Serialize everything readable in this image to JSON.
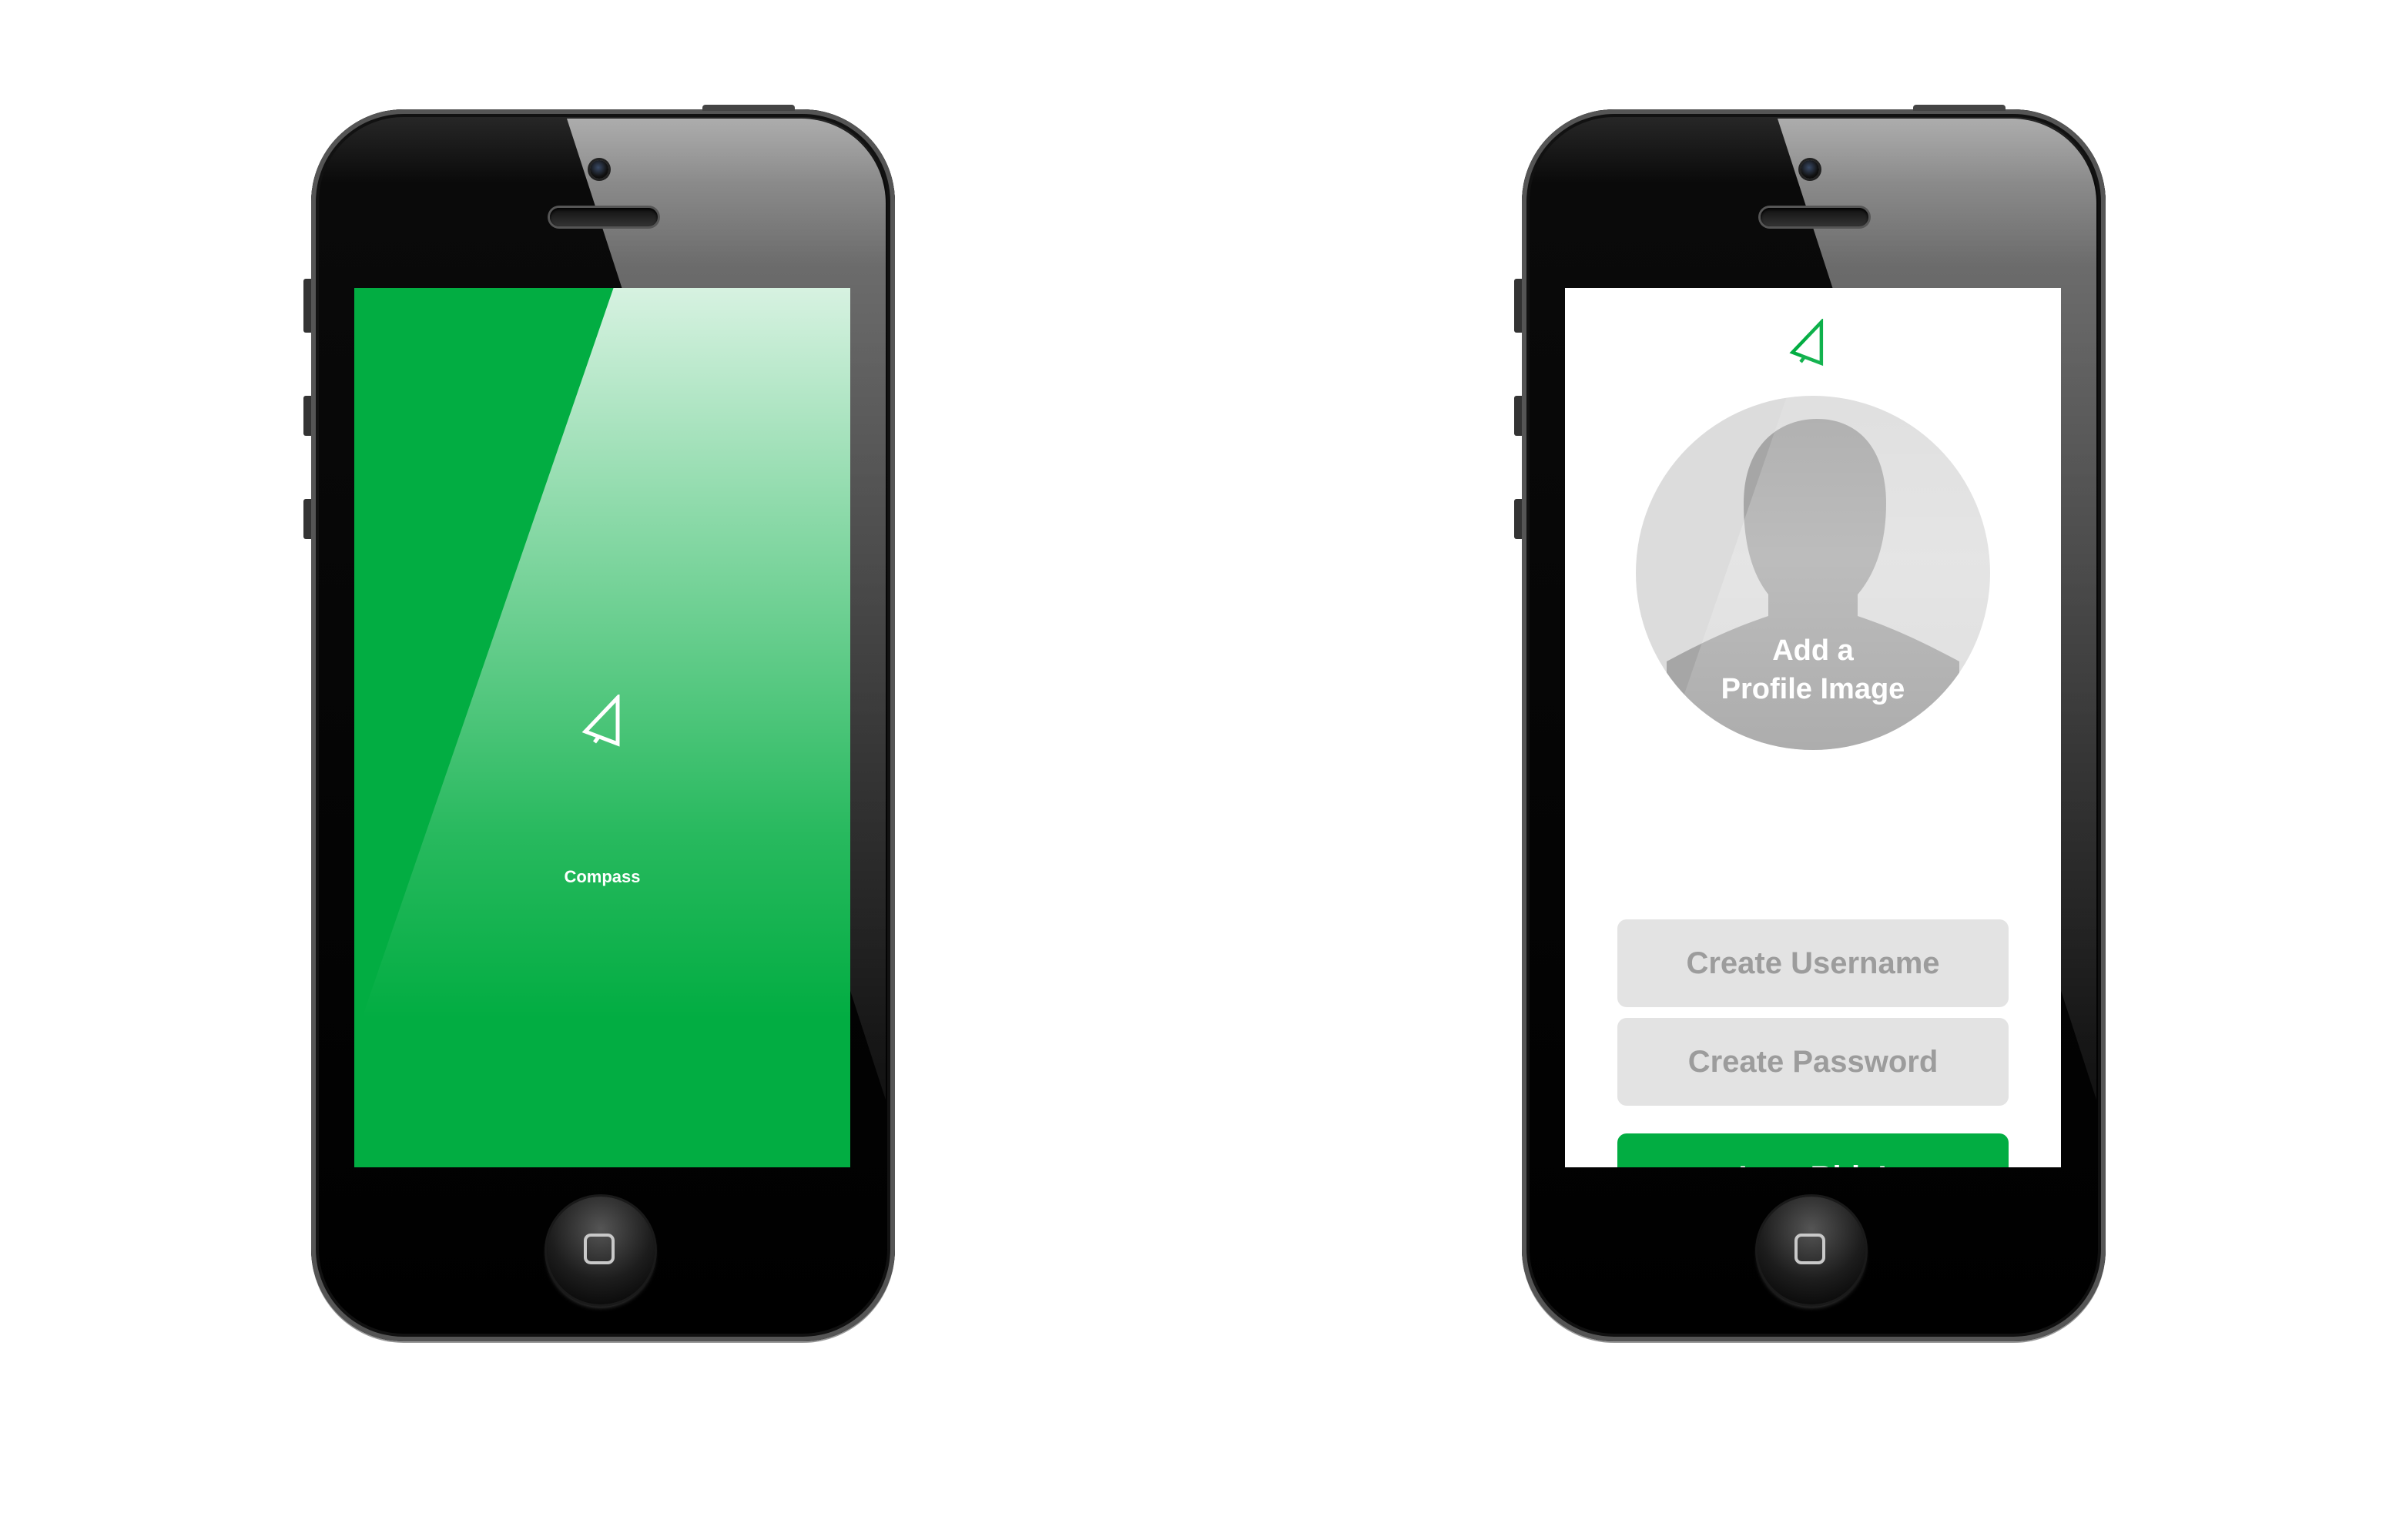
{
  "colors": {
    "brand_green": "#02ad42",
    "page_background": "#ffffff",
    "field_background": "#e3e3e3",
    "field_placeholder": "#9c9c9c",
    "avatar_background": "#dcdcdc",
    "avatar_silhouette": "#a6a6a6"
  },
  "splash_screen": {
    "logo_icon": "compass-arrow-icon",
    "app_name": "Compass"
  },
  "signup_screen": {
    "logo_icon": "compass-arrow-icon",
    "avatar": {
      "icon": "person-silhouette-icon",
      "label_line1": "Add a",
      "label_line2": "Profile Image"
    },
    "username_placeholder": "Create Username",
    "password_placeholder": "Create Password",
    "submit_label": "Lets Ride!"
  }
}
